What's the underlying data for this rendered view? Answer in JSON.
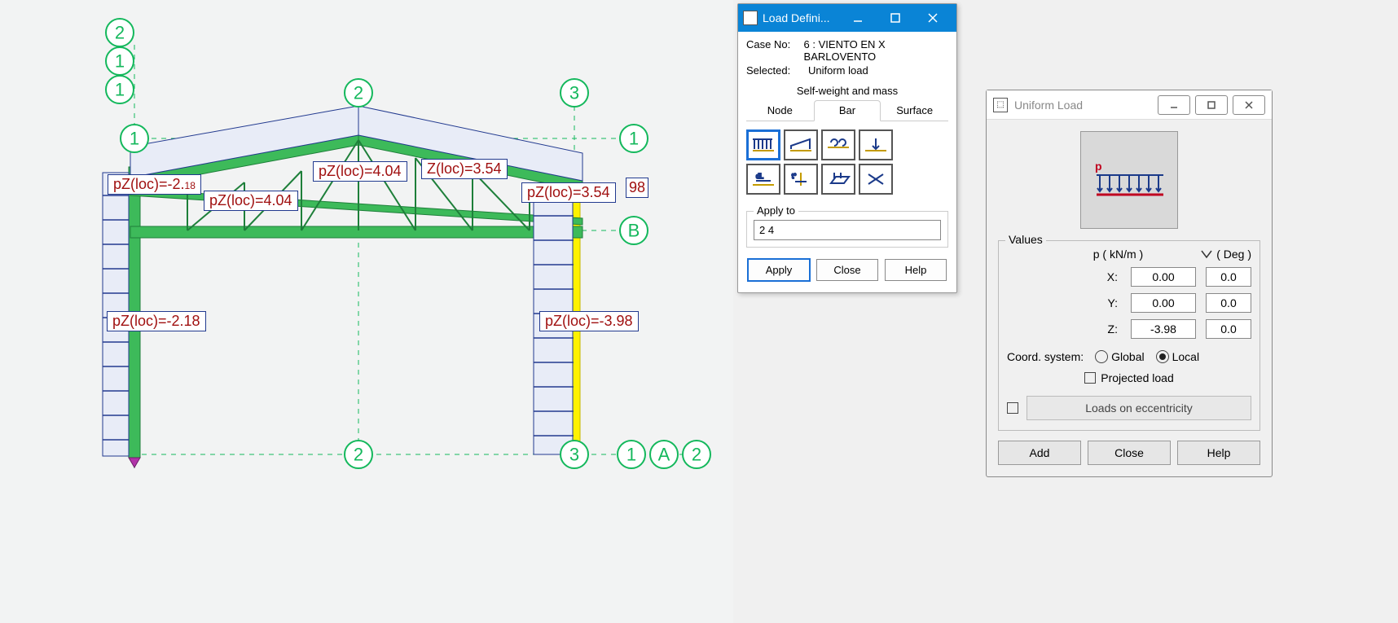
{
  "load_definition": {
    "title": "Load Defini...",
    "case_no_label": "Case No:",
    "case_no_value": "6 : VIENTO EN X BARLOVENTO",
    "selected_label": "Selected:",
    "selected_value": "Uniform load",
    "section_title": "Self-weight and mass",
    "tabs": {
      "node": "Node",
      "bar": "Bar",
      "surface": "Surface"
    },
    "apply_to_label": "Apply to",
    "apply_to_value": "2 4",
    "buttons": {
      "apply": "Apply",
      "close": "Close",
      "help": "Help"
    }
  },
  "uniform_load": {
    "title": "Uniform Load",
    "values_legend": "Values",
    "p_header": "p  ( kN/m )",
    "deg_header": "( Deg )",
    "x_label": "X:",
    "x_val": "0.00",
    "x_deg": "0.0",
    "y_label": "Y:",
    "y_val": "0.00",
    "y_deg": "0.0",
    "z_label": "Z:",
    "z_val": "-3.98",
    "z_deg": "0.0",
    "coord_label": "Coord. system:",
    "global_label": "Global",
    "local_label": "Local",
    "projected_label": "Projected load",
    "ecc_label": "Loads on eccentricity",
    "buttons": {
      "add": "Add",
      "close": "Close",
      "help": "Help"
    }
  },
  "annotations": {
    "a1": "pZ(loc)=-2.",
    "a2": "pZ(loc)=4.04",
    "a3": "pZ(loc)=4.04",
    "a4": "Z(loc)=3.54",
    "a5": "pZ(loc)=3.54",
    "a6": "98",
    "a7": "pZ(loc)=-2.18",
    "a8": "pZ(loc)=-3.98"
  },
  "grids": {
    "top_2": "2",
    "top_1a": "1",
    "top_1b": "1",
    "mid_top_2": "2",
    "mid_top_3": "3",
    "left_1": "1",
    "right_1": "1",
    "right_B": "B",
    "bot_2": "2",
    "bot_3": "3",
    "bot_r1": "1",
    "bot_rA": "A",
    "bot_r2": "2"
  }
}
